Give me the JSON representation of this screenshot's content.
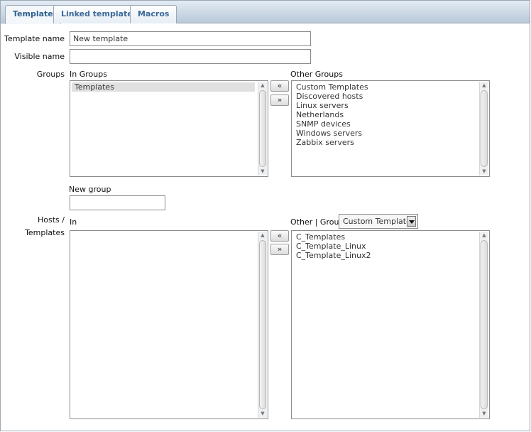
{
  "tabs": [
    "Template",
    "Linked templates",
    "Macros"
  ],
  "form": {
    "template_name_label": "Template name",
    "template_name_value": "New template",
    "visible_name_label": "Visible name",
    "visible_name_value": "",
    "groups_label": "Groups",
    "in_groups_label": "In Groups",
    "in_groups_items": [
      "Templates"
    ],
    "other_groups_label": "Other Groups",
    "other_groups_items": [
      "Custom Templates",
      "Discovered hosts",
      "Linux servers",
      "Netherlands",
      "SNMP devices",
      "Windows servers",
      "Zabbix servers"
    ],
    "move_left": "«",
    "move_right": "»",
    "new_group_label": "New group",
    "new_group_value": "",
    "hosts_templates_label_1": "Hosts /",
    "hosts_templates_label_2": "Templates",
    "in_label": "In",
    "in_items": [],
    "other_group_label": "Other | Group",
    "group_select_value": "Custom Templates",
    "other_items": [
      "C_Templates",
      "C_Template_Linux",
      "C_Template_Linux2"
    ]
  }
}
